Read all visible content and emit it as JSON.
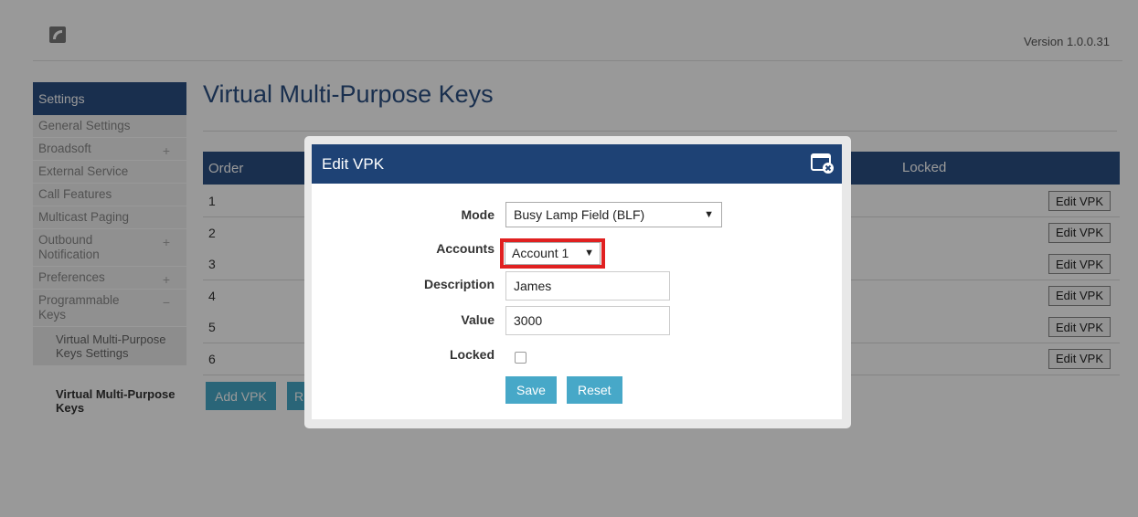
{
  "header": {
    "version": "Version 1.0.0.31"
  },
  "sidebar": {
    "title": "Settings",
    "items": [
      {
        "label": "General Settings",
        "expand": ""
      },
      {
        "label": "Broadsoft",
        "expand": "+"
      },
      {
        "label": "External Service",
        "expand": ""
      },
      {
        "label": "Call Features",
        "expand": ""
      },
      {
        "label": "Multicast Paging",
        "expand": ""
      },
      {
        "label": "Outbound Notification",
        "expand": "+"
      },
      {
        "label": "Preferences",
        "expand": "+"
      },
      {
        "label": "Programmable Keys",
        "expand": "−"
      }
    ],
    "sub_item": "Virtual Multi-Purpose Keys Settings",
    "active_item": "Virtual Multi-Purpose Keys"
  },
  "main": {
    "title": "Virtual Multi-Purpose Keys",
    "columns": {
      "order": "Order",
      "locked": "Locked"
    },
    "rows": [
      {
        "order": "1",
        "edit_label": "Edit VPK"
      },
      {
        "order": "2",
        "edit_label": "Edit VPK"
      },
      {
        "order": "3",
        "edit_label": "Edit VPK"
      },
      {
        "order": "4",
        "edit_label": "Edit VPK"
      },
      {
        "order": "5",
        "edit_label": "Edit VPK"
      },
      {
        "order": "6",
        "edit_label": "Edit VPK"
      }
    ],
    "add_label": "Add VPK",
    "second_btn_partial": "R"
  },
  "modal": {
    "title": "Edit VPK",
    "mode_label": "Mode",
    "mode_value": "Busy Lamp Field (BLF)",
    "accounts_label": "Accounts",
    "accounts_value": "Account 1",
    "description_label": "Description",
    "description_value": "James",
    "value_label": "Value",
    "value_value": "3000",
    "locked_label": "Locked",
    "locked_checked": false,
    "save_label": "Save",
    "reset_label": "Reset"
  },
  "colors": {
    "brand_blue": "#2b4f82",
    "modal_header": "#1e4275",
    "action_button": "#47a8c8",
    "highlight": "#e02020"
  }
}
